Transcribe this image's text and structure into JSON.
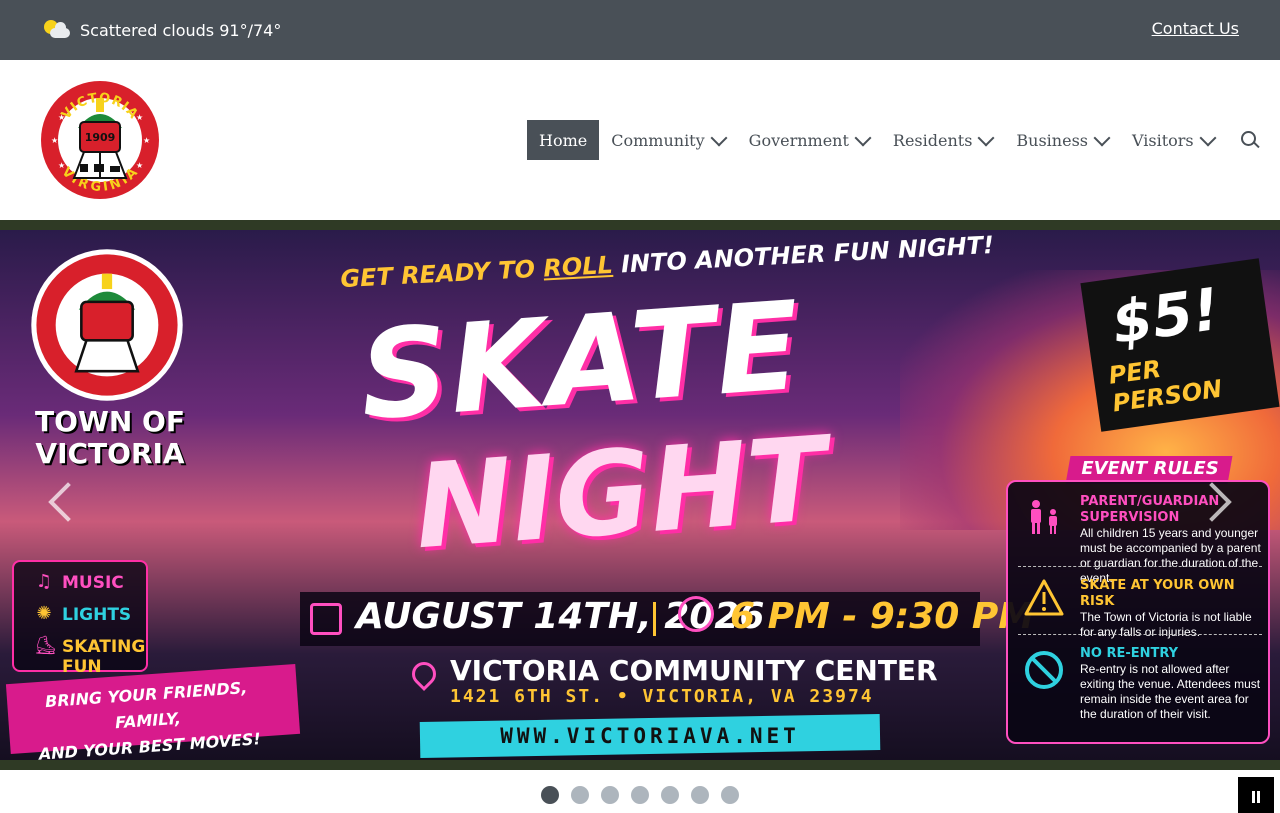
{
  "topbar": {
    "weather_icon": "partly-cloudy-icon",
    "weather_text": "Scattered clouds 91°/74°",
    "contact_label": "Contact Us",
    "background": "#495057"
  },
  "logo": {
    "top_text": "VICTORIA",
    "bottom_text": "VIRGINIA",
    "year": "1909",
    "red": "#d8202b",
    "green": "#1d8a3a"
  },
  "nav": {
    "items": [
      {
        "label": "Home",
        "active": true,
        "dropdown": false
      },
      {
        "label": "Community",
        "active": false,
        "dropdown": true
      },
      {
        "label": "Government",
        "active": false,
        "dropdown": true
      },
      {
        "label": "Residents",
        "active": false,
        "dropdown": true
      },
      {
        "label": "Business",
        "active": false,
        "dropdown": true
      },
      {
        "label": "Visitors",
        "active": false,
        "dropdown": true
      }
    ],
    "search_icon": "search-icon"
  },
  "slide": {
    "town_line1": "TOWN OF",
    "town_line2": "VICTORIA",
    "hype_a": "GET READY TO ",
    "hype_roll": "ROLL",
    "hype_b": " INTO ANOTHER FUN NIGHT!",
    "title_1": "SKATE",
    "title_2": "NIGHT",
    "price": "$5!",
    "price_unit": "PER PERSON",
    "features": [
      {
        "icon": "music-note-icon",
        "label": "MUSIC",
        "color": "#ff4fc0"
      },
      {
        "icon": "lightbulb-icon",
        "label": "LIGHTS",
        "color": "#2fd1e0"
      },
      {
        "icon": "roller-skate-icon",
        "label": "SKATING FUN",
        "color": "#ffc533"
      }
    ],
    "bring_1": "BRING YOUR FRIENDS, FAMILY,",
    "bring_2": "AND YOUR BEST MOVES!",
    "date": "AUGUST 14TH, 2026",
    "time": "6 PM - 9:30 PM",
    "venue": "VICTORIA COMMUNITY CENTER",
    "address": "1421 6TH ST. • VICTORIA, VA 23974",
    "url": "WWW.VICTORIAVA.NET",
    "rules_title": "EVENT RULES",
    "rules": [
      {
        "icon": "family-icon",
        "title": "PARENT/GUARDIAN SUPERVISION",
        "title_color": "#ff4fc0",
        "body": "All children 15 years and younger must be accompanied by a parent or guardian for the duration of the event."
      },
      {
        "icon": "warning-icon",
        "title": "SKATE AT YOUR OWN RISK",
        "title_color": "#ffc533",
        "body": "The Town of Victoria is not liable for any falls or injuries."
      },
      {
        "icon": "no-entry-icon",
        "title": "NO RE-ENTRY",
        "title_color": "#2fd1e0",
        "body": "Re-entry is not allowed after exiting the venue. Attendees must remain inside the event area for the duration of their visit."
      }
    ]
  },
  "slider": {
    "total_slides": 7,
    "current_slide": 1
  }
}
